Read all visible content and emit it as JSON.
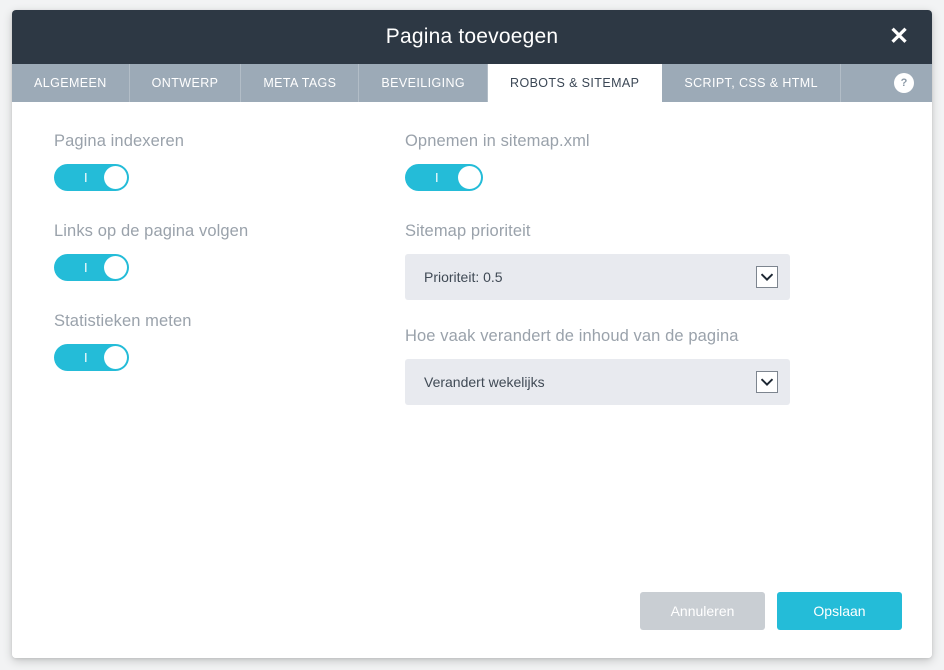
{
  "window": {
    "title": "Pagina toevoegen",
    "close_label": "✕"
  },
  "tabs": [
    {
      "label": "ALGEMEEN",
      "active": false
    },
    {
      "label": "ONTWERP",
      "active": false
    },
    {
      "label": "META TAGS",
      "active": false
    },
    {
      "label": "BEVEILIGING",
      "active": false
    },
    {
      "label": "ROBOTS & SITEMAP",
      "active": true
    },
    {
      "label": "SCRIPT, CSS & HTML",
      "active": false
    }
  ],
  "help": {
    "label": "?"
  },
  "left_column": [
    {
      "label": "Pagina indexeren",
      "toggle_on": true,
      "toggle_mark": "I"
    },
    {
      "label": "Links op de pagina volgen",
      "toggle_on": true,
      "toggle_mark": "I"
    },
    {
      "label": "Statistieken meten",
      "toggle_on": true,
      "toggle_mark": "I"
    }
  ],
  "right_column": {
    "sitemap_toggle": {
      "label": "Opnemen in sitemap.xml",
      "toggle_on": true,
      "toggle_mark": "I"
    },
    "priority": {
      "label": "Sitemap prioriteit",
      "value": "Prioriteit: 0.5"
    },
    "changefreq": {
      "label": "Hoe vaak verandert de inhoud van de pagina",
      "value": "Verandert wekelijks"
    }
  },
  "footer": {
    "cancel_label": "Annuleren",
    "save_label": "Opslaan"
  },
  "colors": {
    "header_bg": "#2d3844",
    "tabbar_bg": "#9caab7",
    "accent": "#24bcd8",
    "cancel": "#c9ced3",
    "select_bg": "#e8eaef",
    "label_text": "#9aa2ab"
  }
}
